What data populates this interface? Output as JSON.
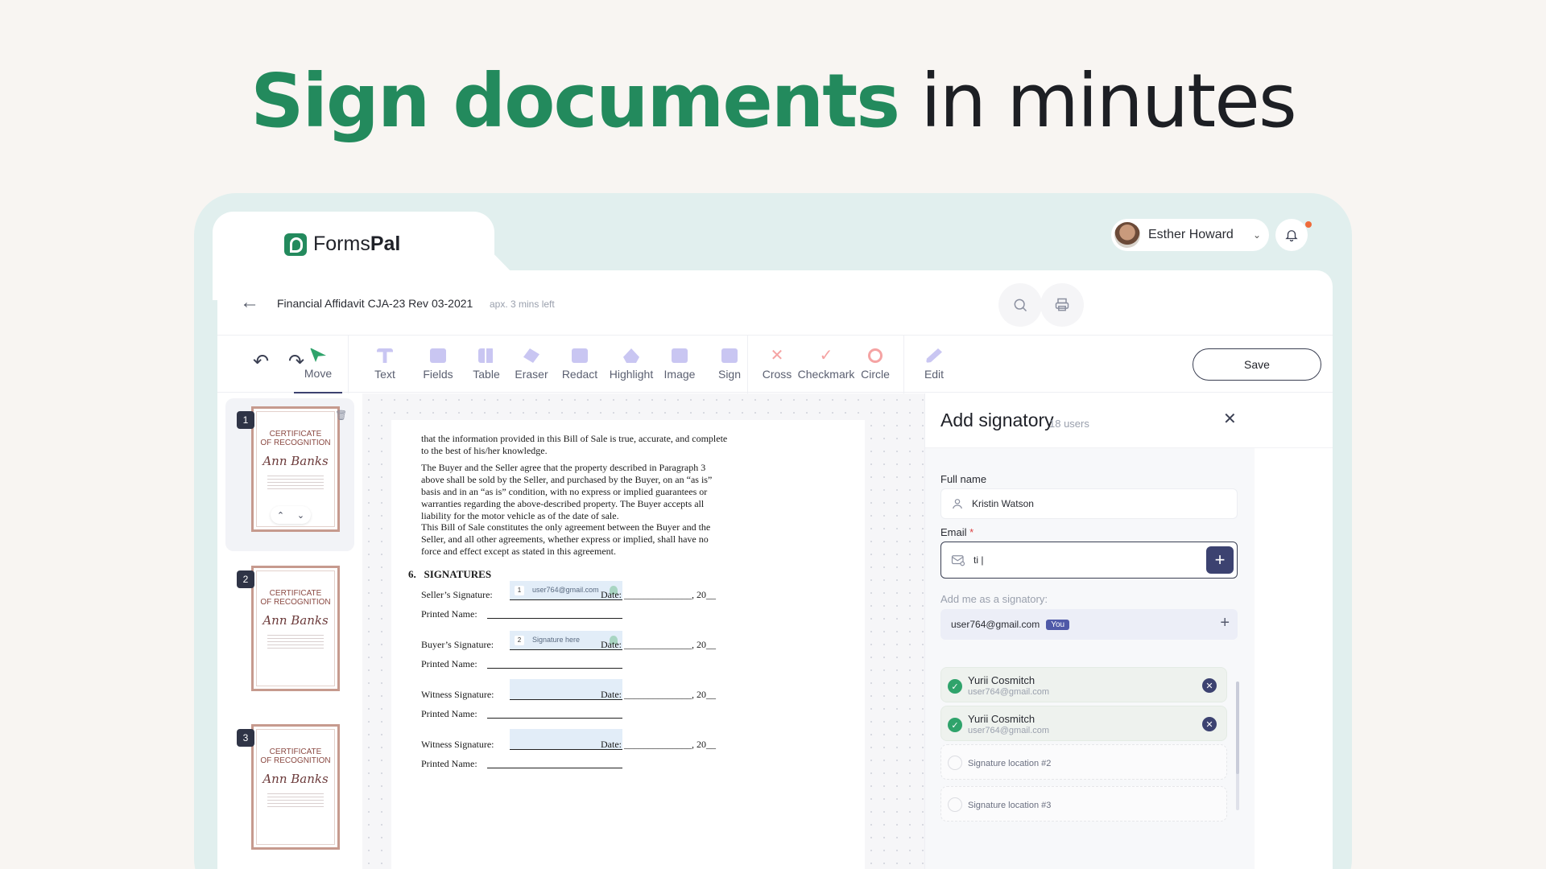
{
  "hero": {
    "strong": "Sign documents",
    "rest": "in minutes"
  },
  "brand": {
    "part1": "Forms",
    "part2": "Pal"
  },
  "user": {
    "name": "Esther Howard"
  },
  "document": {
    "title": "Financial Affidavit CJA-23 Rev 03-2021",
    "time_left": "apx. 3 mins left"
  },
  "toolbar": {
    "tools": [
      {
        "label": "Move",
        "icon": "cursor-icon",
        "color": "#2fa36b"
      },
      {
        "label": "Text",
        "icon": "text-icon",
        "color": "#c9c6f2"
      },
      {
        "label": "Fields",
        "icon": "fields-icon",
        "color": "#c9c6f2"
      },
      {
        "label": "Table",
        "icon": "table-icon",
        "color": "#c9c6f2"
      },
      {
        "label": "Eraser",
        "icon": "eraser-icon",
        "color": "#c9c6f2"
      },
      {
        "label": "Redact",
        "icon": "redact-icon",
        "color": "#c9c6f2"
      },
      {
        "label": "Highlight",
        "icon": "highlight-icon",
        "color": "#c9c6f2"
      },
      {
        "label": "Image",
        "icon": "image-icon",
        "color": "#c9c6f2"
      },
      {
        "label": "Sign",
        "icon": "sign-icon",
        "color": "#c9c6f2"
      },
      {
        "label": "Cross",
        "icon": "cross-icon",
        "color": "#f5a3a3"
      },
      {
        "label": "Checkmark",
        "icon": "checkmark-icon",
        "color": "#f5a3a3"
      },
      {
        "label": "Circle",
        "icon": "circle-icon",
        "color": "#f5a3a3"
      },
      {
        "label": "Edit",
        "icon": "pencil-icon",
        "color": "#c9c6f2"
      }
    ],
    "save_label": "Save"
  },
  "thumbnails": [
    {
      "num": "1",
      "title1": "CERTIFICATE",
      "title2": "OF RECOGNITION",
      "name": "Ann Banks"
    },
    {
      "num": "2",
      "title1": "CERTIFICATE",
      "title2": "OF RECOGNITION",
      "name": "Ann Banks"
    },
    {
      "num": "3",
      "title1": "CERTIFICATE",
      "title2": "OF RECOGNITION",
      "name": "Ann Banks"
    }
  ],
  "paper": {
    "p1": "that the information provided in this Bill of Sale is true, accurate, and complete to the best of his/her knowledge.",
    "p2": "The Buyer and the Seller agree that the property described in Paragraph 3 above shall be sold by the Seller, and purchased by the Buyer, on an “as is” basis and in an “as is” condition, with no express or implied guarantees or warranties regarding the above-described property.  The Buyer accepts all liability for the motor vehicle as of the date of sale.",
    "p3": "This Bill of Sale constitutes the only agreement between the Buyer and the Seller, and all other agreements, whether express or implied, shall have no force and effect except as stated in this agreement.",
    "section_num": "6.",
    "section": "SIGNATURES",
    "seller_label": "Seller’s Signature:",
    "buyer_label": "Buyer’s Signature:",
    "witness_label": "Witness Signature:",
    "printed_label": "Printed Name:",
    "date_label": "Date:",
    "year_suffix": ", 20__",
    "field1_num": "1",
    "field1_text": "user764@gmail.com",
    "field2_num": "2",
    "field2_text": "Signature here"
  },
  "signatory": {
    "title": "Add signatory",
    "count": "18 users",
    "full_name_label": "Full name",
    "full_name_value": "Kristin Watson",
    "email_label": "Email",
    "email_required": "*",
    "email_value": "ti |",
    "add_me_label": "Add me as a signatory:",
    "me_email": "user764@gmail.com",
    "you_badge": "You",
    "signers": [
      {
        "name": "Yurii Cosmitch",
        "email": "user764@gmail.com"
      },
      {
        "name": "Yurii Cosmitch",
        "email": "user764@gmail.com"
      }
    ],
    "locations": [
      "Signature location #2",
      "Signature location #3"
    ]
  }
}
